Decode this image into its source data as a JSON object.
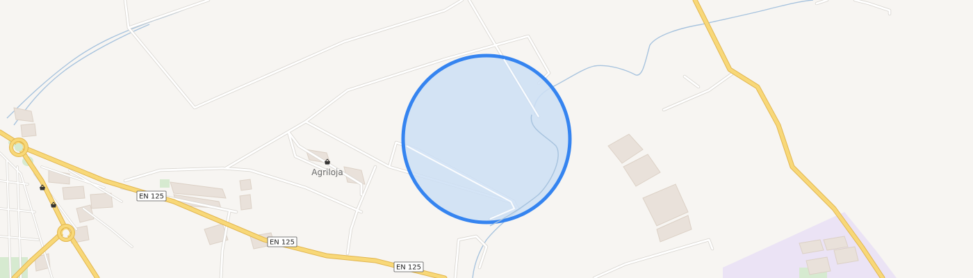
{
  "map": {
    "colors": {
      "background": "#f7f5f2",
      "minor_road": "#ffffff",
      "minor_road_casing": "#d9d6d1",
      "primary_road": "#f8d878",
      "primary_road_casing": "#e2b64f",
      "water": "#a7c3de",
      "building": "#e9e1da",
      "building_stroke": "#dcd1c6",
      "park": "#d6ead0",
      "industrial": "#ebe3f5",
      "location_fill": "#cddff5",
      "location_stroke": "#3584f0"
    },
    "road_labels": [
      {
        "id": "en125-a",
        "text": "EN 125"
      },
      {
        "id": "en125-b",
        "text": "EN 125"
      },
      {
        "id": "en125-c",
        "text": "EN 125"
      }
    ],
    "pois": [
      {
        "id": "agriloja",
        "name": "Agriloja",
        "icon": "shop-basket-icon"
      },
      {
        "id": "shop-west-1",
        "name": "",
        "icon": "shop-basket-icon"
      },
      {
        "id": "shop-west-2",
        "name": "",
        "icon": "shop-basket-icon"
      }
    ],
    "location_marker": {
      "icon": "location-accuracy-circle"
    }
  }
}
